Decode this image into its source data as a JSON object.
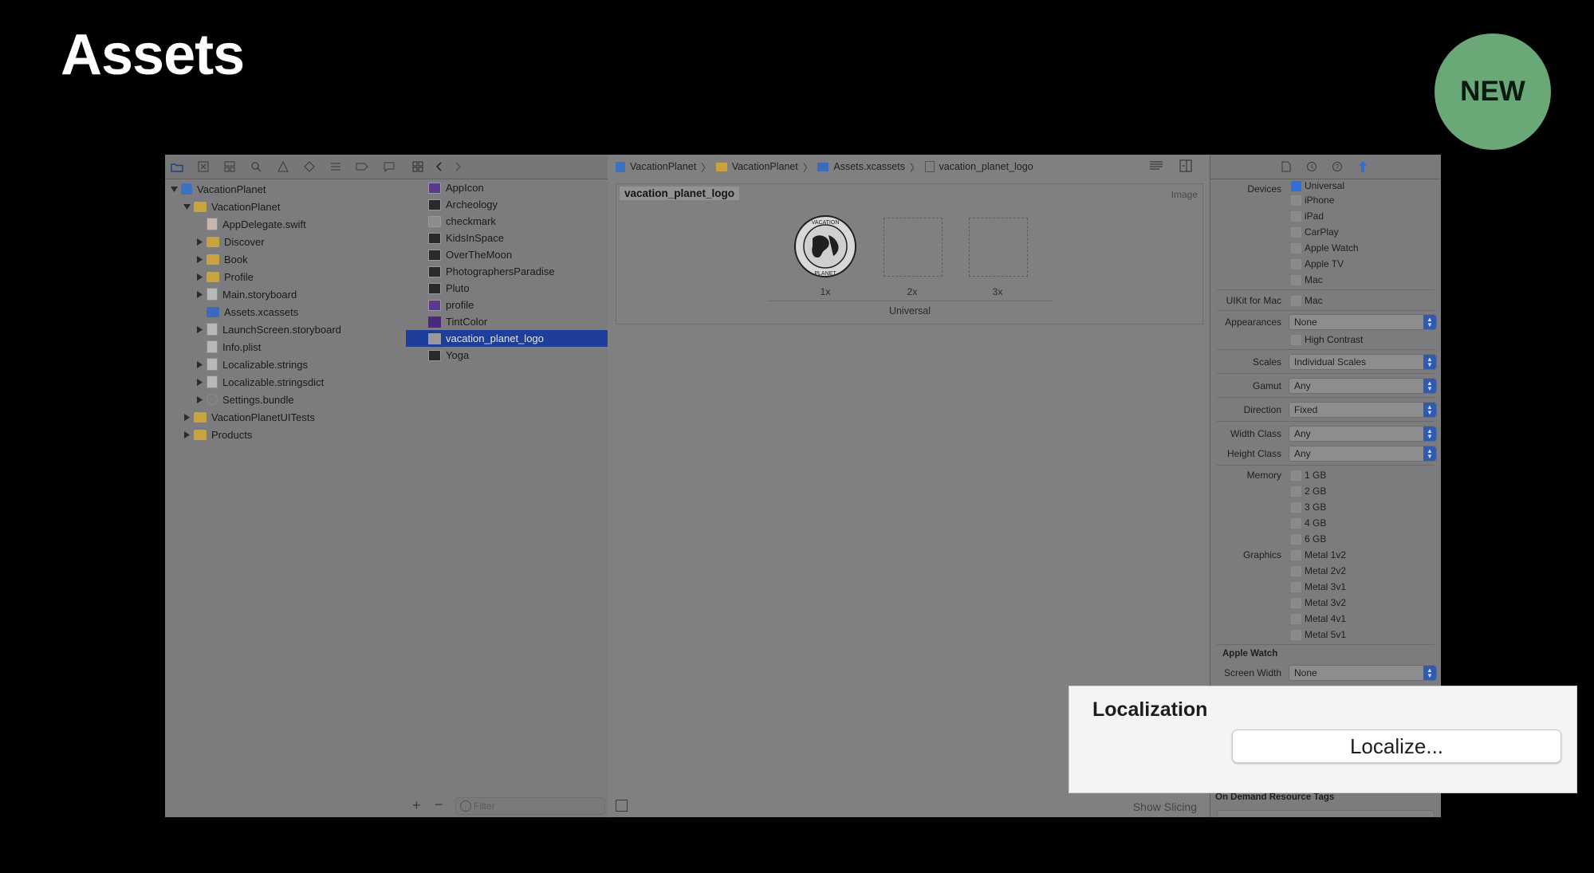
{
  "slide": {
    "title": "Assets",
    "badge": "NEW"
  },
  "navigator": {
    "items": [
      {
        "label": "VacationPlanet"
      },
      {
        "label": "VacationPlanet"
      },
      {
        "label": "AppDelegate.swift"
      },
      {
        "label": "Discover"
      },
      {
        "label": "Book"
      },
      {
        "label": "Profile"
      },
      {
        "label": "Main.storyboard"
      },
      {
        "label": "Assets.xcassets"
      },
      {
        "label": "LaunchScreen.storyboard"
      },
      {
        "label": "Info.plist"
      },
      {
        "label": "Localizable.strings"
      },
      {
        "label": "Localizable.stringsdict"
      },
      {
        "label": "Settings.bundle"
      },
      {
        "label": "VacationPlanetUITests"
      },
      {
        "label": "Products"
      }
    ]
  },
  "asset_list": {
    "items": [
      "AppIcon",
      "Archeology",
      "checkmark",
      "KidsInSpace",
      "OverTheMoon",
      "PhotographersParadise",
      "Pluto",
      "profile",
      "TintColor",
      "vacation_planet_logo",
      "Yoga"
    ],
    "selected": "vacation_planet_logo",
    "filter_placeholder": "Filter"
  },
  "breadcrumb": {
    "items": [
      "VacationPlanet",
      "VacationPlanet",
      "Assets.xcassets",
      "vacation_planet_logo"
    ]
  },
  "editor": {
    "set_name": "vacation_planet_logo",
    "set_type": "Image",
    "logo_text_top": "VACATION",
    "logo_text_bottom": "PLANET",
    "slots": [
      "1x",
      "2x",
      "3x"
    ],
    "group_label": "Universal",
    "show_slicing": "Show Slicing"
  },
  "inspector": {
    "devices_label": "Devices",
    "devices": [
      {
        "name": "Universal",
        "checked": true
      },
      {
        "name": "iPhone",
        "checked": false
      },
      {
        "name": "iPad",
        "checked": false
      },
      {
        "name": "CarPlay",
        "checked": false
      },
      {
        "name": "Apple Watch",
        "checked": false
      },
      {
        "name": "Apple TV",
        "checked": false
      },
      {
        "name": "Mac",
        "checked": false
      }
    ],
    "uikit_label": "UIKit for Mac",
    "uikit_value": "Mac",
    "appearances_label": "Appearances",
    "appearances_value": "None",
    "high_contrast": "High Contrast",
    "scales_label": "Scales",
    "scales_value": "Individual Scales",
    "gamut_label": "Gamut",
    "gamut_value": "Any",
    "direction_label": "Direction",
    "direction_value": "Fixed",
    "width_label": "Width Class",
    "width_value": "Any",
    "height_label": "Height Class",
    "height_value": "Any",
    "memory_label": "Memory",
    "memory": [
      "1 GB",
      "2 GB",
      "3 GB",
      "4 GB",
      "6 GB"
    ],
    "graphics_label": "Graphics",
    "graphics": [
      "Metal 1v2",
      "Metal 2v2",
      "Metal 3v1",
      "Metal 3v2",
      "Metal 4v1",
      "Metal 5v1"
    ],
    "apple_watch_header": "Apple Watch",
    "screen_width_label": "Screen Width",
    "screen_width_value": "None",
    "on_demand_header": "On Demand Resource Tags"
  },
  "popup": {
    "title": "Localization",
    "button": "Localize..."
  },
  "colors": {
    "selection": "#1d3e9a",
    "badge": "#6aa878",
    "accent": "#2e6ed8"
  }
}
